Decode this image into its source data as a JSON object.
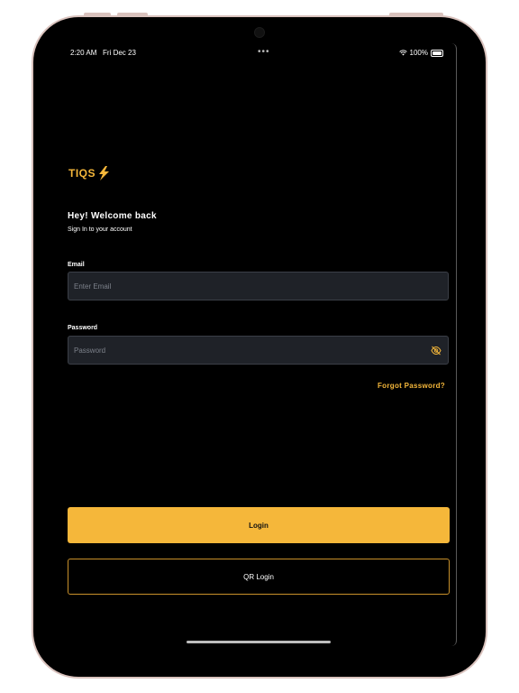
{
  "status_bar": {
    "time": "2:20 AM",
    "date": "Fri Dec 23",
    "battery": "100%",
    "dots": "•••"
  },
  "brand": {
    "logo_text": "TIQS",
    "accent": "#f5b73a"
  },
  "welcome": {
    "title": "Hey! Welcome back",
    "subtitle": "Sign In to your account"
  },
  "email": {
    "label": "Email",
    "placeholder": "Enter Email",
    "value": ""
  },
  "password": {
    "label": "Password",
    "placeholder": "Password",
    "value": ""
  },
  "forgot_label": "Forgot Password?",
  "login_label": "Login",
  "qr_login_label": "QR Login"
}
